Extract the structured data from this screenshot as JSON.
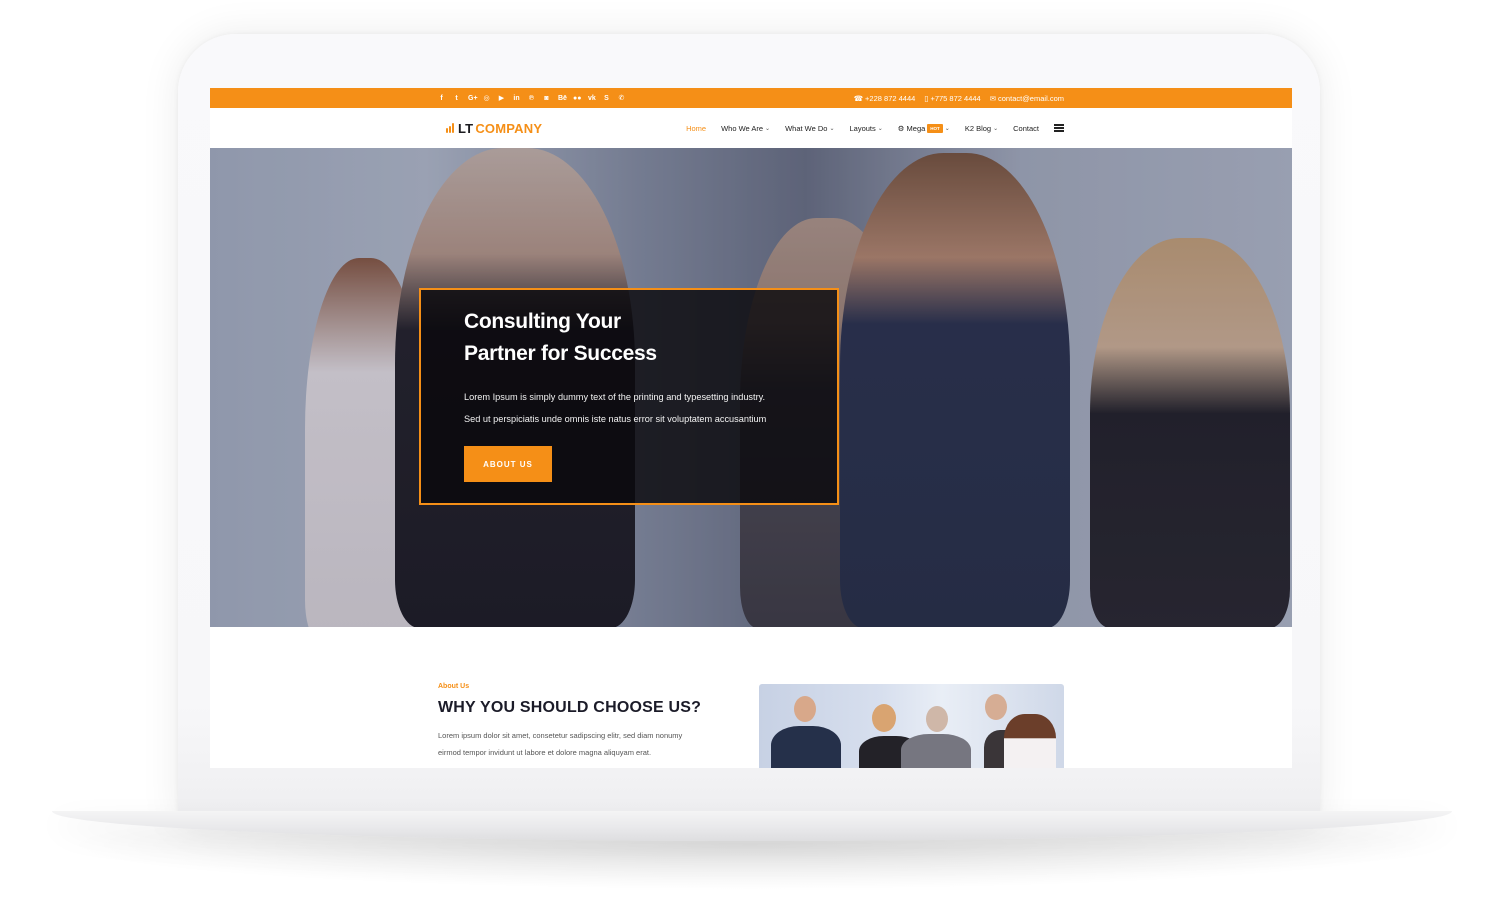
{
  "brand": {
    "accent_color": "#f58f17",
    "dark_text_color": "#1b1b28"
  },
  "topbar": {
    "social_icons": [
      {
        "name": "facebook-icon",
        "glyph": "f"
      },
      {
        "name": "twitter-icon",
        "glyph": "t"
      },
      {
        "name": "google-plus-icon",
        "glyph": "G+"
      },
      {
        "name": "dribbble-icon",
        "glyph": "◎"
      },
      {
        "name": "youtube-icon",
        "glyph": "▶"
      },
      {
        "name": "linkedin-icon",
        "glyph": "in"
      },
      {
        "name": "pinterest-icon",
        "glyph": "℗"
      },
      {
        "name": "instagram-icon",
        "glyph": "◙"
      },
      {
        "name": "behance-icon",
        "glyph": "Bē"
      },
      {
        "name": "flickr-icon",
        "glyph": "●●"
      },
      {
        "name": "vk-icon",
        "glyph": "vk"
      },
      {
        "name": "skype-icon",
        "glyph": "S"
      },
      {
        "name": "whatsapp-icon",
        "glyph": "✆"
      }
    ],
    "phone_1": "+228 872 4444",
    "phone_2": "+775 872 4444",
    "email": "contact@email.com",
    "phone_icon": "☎",
    "mobile_icon": "▯",
    "email_icon": "✉"
  },
  "nav": {
    "logo_prefix": "LT",
    "logo_suffix": "COMPANY",
    "items": [
      {
        "label": "Home",
        "active": true,
        "dropdown": false
      },
      {
        "label": "Who We Are",
        "dropdown": true
      },
      {
        "label": "What We Do",
        "dropdown": true
      },
      {
        "label": "Layouts",
        "dropdown": true
      },
      {
        "label": "Mega",
        "dropdown": true,
        "badge": "HOT",
        "icon": "⚙"
      },
      {
        "label": "K2 Blog",
        "dropdown": true
      },
      {
        "label": "Contact",
        "dropdown": false
      }
    ],
    "chevron": "⌄"
  },
  "hero": {
    "title_line_1": "Consulting Your",
    "title_line_2": "Partner for Success",
    "text_line_1": "Lorem Ipsum is simply dummy text of the printing and typesetting industry.",
    "text_line_2": "Sed ut perspiciatis unde omnis iste natus error sit voluptatem accusantium",
    "button_label": "ABOUT US"
  },
  "about": {
    "kicker": "About Us",
    "title": "WHY YOU SHOULD CHOOSE US?",
    "text_line_1": "Lorem ipsum dolor sit amet, consetetur sadipscing elitr, sed diam nonumy",
    "text_line_2": "eirmod tempor invidunt ut labore et dolore magna aliquyam erat."
  }
}
